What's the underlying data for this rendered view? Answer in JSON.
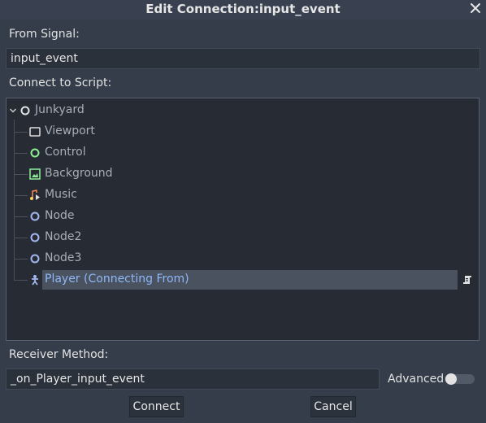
{
  "dialog": {
    "title": "Edit Connection:input_event",
    "close_icon": "close-icon"
  },
  "from_signal": {
    "label": "From Signal:",
    "value": "input_event"
  },
  "connect_to_script": {
    "label": "Connect to Script:",
    "tree": [
      {
        "label": "Junkyard",
        "icon": "node-circle-icon",
        "icon_color": "#e0e0e0",
        "collapse_icon": "chevron-down-icon"
      },
      {
        "label": "Viewport",
        "icon": "viewport-icon",
        "icon_color": "#e0e0e0"
      },
      {
        "label": "Control",
        "icon": "control-icon",
        "icon_color": "#8eef97"
      },
      {
        "label": "Background",
        "icon": "texture-rect-icon",
        "icon_color": "#8eef97"
      },
      {
        "label": "Music",
        "icon": "audio-stream-player-icon",
        "icon_color": "#e0e0e0"
      },
      {
        "label": "Node",
        "icon": "node-circle-icon",
        "icon_color": "#a5b7f3"
      },
      {
        "label": "Node2",
        "icon": "node-circle-icon",
        "icon_color": "#a5b7f3"
      },
      {
        "label": "Node3",
        "icon": "node-circle-icon",
        "icon_color": "#a5b7f3"
      },
      {
        "label": "Player (Connecting From)",
        "icon": "kinematic-body-icon",
        "icon_color": "#a5b7f3",
        "selected": true,
        "script_icon": "script-icon"
      }
    ]
  },
  "receiver_method": {
    "label": "Receiver Method:",
    "value": "_on_Player_input_event"
  },
  "advanced": {
    "label": "Advanced",
    "enabled": false
  },
  "buttons": {
    "connect": "Connect",
    "cancel": "Cancel"
  },
  "colors": {
    "background": "#363d4a",
    "tree_background": "#262b34",
    "selected_row": "#4a5260",
    "selected_text": "#8fb6f7",
    "node_blue": "#a5b7f3",
    "node_green": "#8eef97"
  }
}
